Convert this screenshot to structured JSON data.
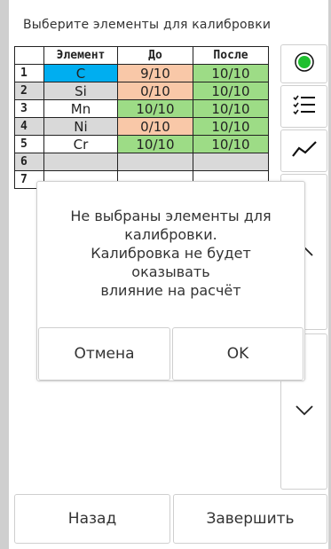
{
  "title": "Выберите элементы для калибровки",
  "table": {
    "headers": [
      "",
      "Элемент",
      "До",
      "После"
    ],
    "rows": [
      {
        "num": "1",
        "element": "C",
        "before": "9/10",
        "after": "10/10"
      },
      {
        "num": "2",
        "element": "Si",
        "before": "0/10",
        "after": "10/10"
      },
      {
        "num": "3",
        "element": "Mn",
        "before": "10/10",
        "after": "10/10"
      },
      {
        "num": "4",
        "element": "Ni",
        "before": "0/10",
        "after": "10/10"
      },
      {
        "num": "5",
        "element": "Cr",
        "before": "10/10",
        "after": "10/10"
      },
      {
        "num": "6",
        "element": "",
        "before": "",
        "after": ""
      },
      {
        "num": "7",
        "element": "",
        "before": "",
        "after": ""
      }
    ]
  },
  "colors": {
    "element_selected": "#00aef0",
    "element_gray": "#d9d9d9",
    "status_orange": "#f9c8a8",
    "status_green": "#9ddc86",
    "record_dot": "#1fbf2f"
  },
  "side_buttons": {
    "record_icon": "record-dot-icon",
    "list_icon": "checklist-icon",
    "chart_icon": "line-chart-icon",
    "scroll_up_icon": "chevron-up-icon",
    "scroll_down_icon": "chevron-down-icon"
  },
  "dialog": {
    "message": "Не выбраны элементы для\nкалибровки.\nКалибровка не будет\nоказывать\nвлияние на расчёт",
    "cancel_label": "Отмена",
    "ok_label": "OK"
  },
  "footer": {
    "back_label": "Назад",
    "finish_label": "Завершить"
  }
}
